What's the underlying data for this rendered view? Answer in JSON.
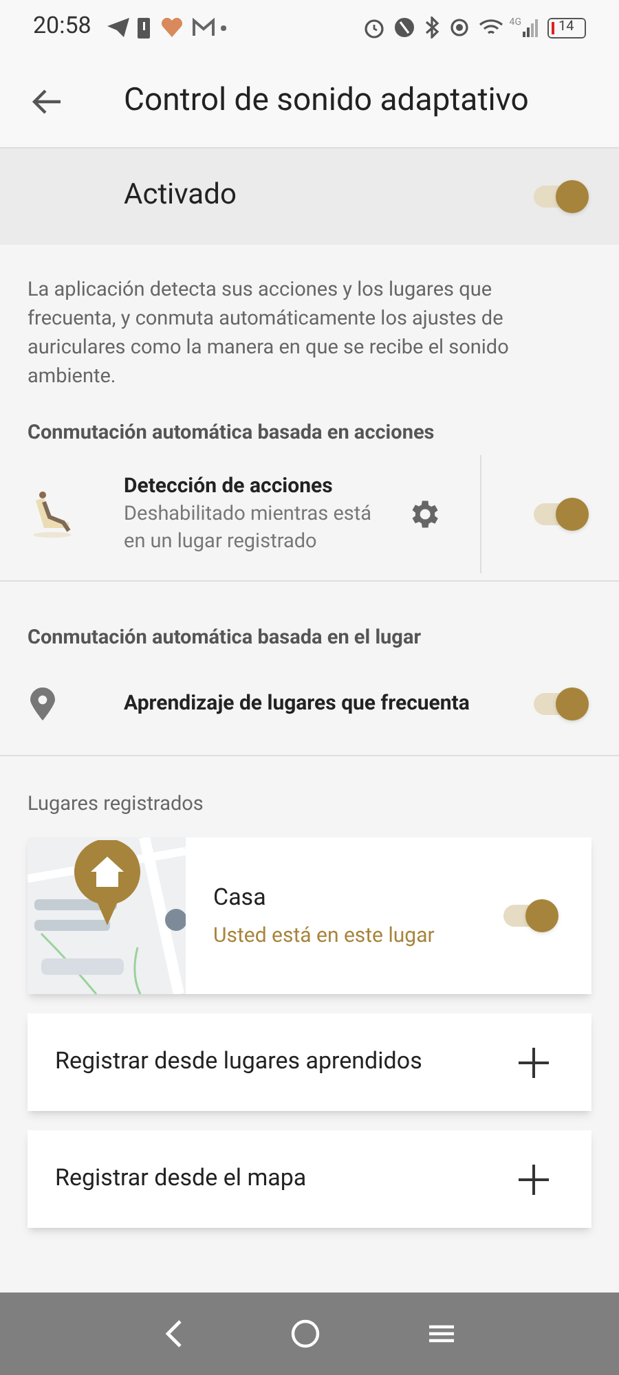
{
  "status_bar": {
    "time": "20:58",
    "network": "4G",
    "battery": "14"
  },
  "header": {
    "title": "Control de sonido adaptativo"
  },
  "master": {
    "label": "Activado",
    "on": true
  },
  "description": "La aplicación detecta sus acciones y los lugares que frecuenta, y conmuta automáticamente los ajustes de auriculares como la manera en que se recibe el sonido ambiente.",
  "sections": [
    {
      "title": "Conmutación automática basada en acciones",
      "rows": [
        {
          "kind": "action",
          "title": "Detección de acciones",
          "subtitle": "Deshabilitado mientras está en un lugar registrado",
          "on": true
        }
      ]
    },
    {
      "title": "Conmutación automática basada en el lugar",
      "rows": [
        {
          "kind": "place",
          "title": "Aprendizaje de lugares que frecuenta",
          "on": true
        }
      ]
    }
  ],
  "places": {
    "title": "Lugares registrados",
    "items": [
      {
        "name": "Casa",
        "status": "Usted está en este lugar",
        "on": true
      }
    ]
  },
  "add_buttons": [
    {
      "label": "Registrar desde lugares aprendidos"
    },
    {
      "label": "Registrar desde el mapa"
    }
  ]
}
